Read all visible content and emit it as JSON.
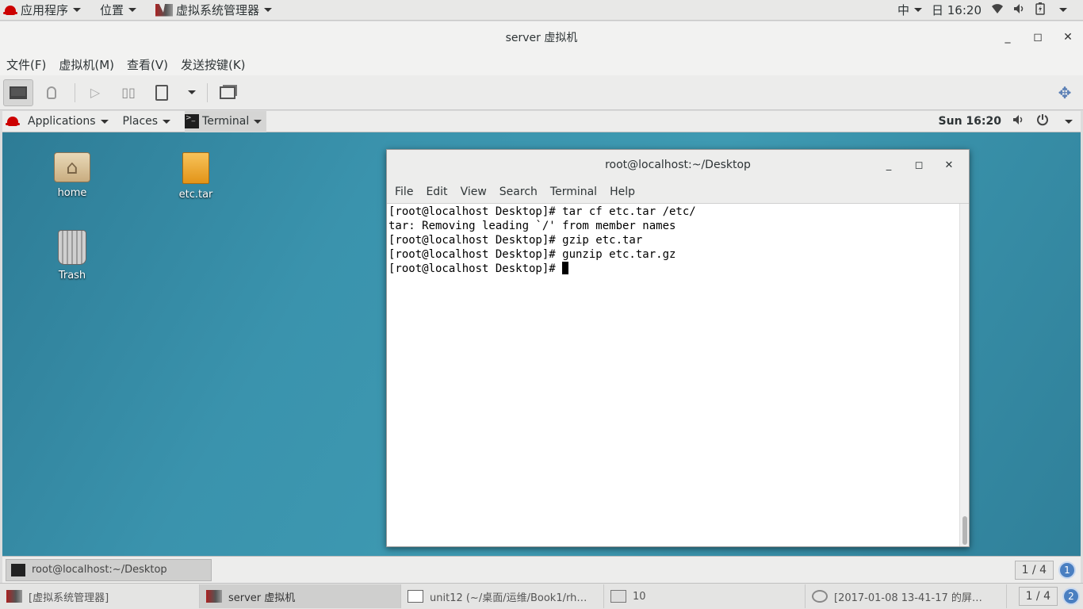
{
  "host_topbar": {
    "apps_menu": "应用程序",
    "places_menu": "位置",
    "vm_manager_menu": "虚拟系统管理器",
    "input_method": "中",
    "clock": "日 16:20"
  },
  "vm_window": {
    "title": "server 虚拟机",
    "menu": [
      "文件(F)",
      "虚拟机(M)",
      "查看(V)",
      "发送按键(K)"
    ]
  },
  "guest": {
    "topbar": {
      "applications": "Applications",
      "places": "Places",
      "terminal": "Terminal",
      "clock": "Sun 16:20"
    },
    "desktop_icons": {
      "home": "home",
      "etc_tar": "etc.tar",
      "trash": "Trash"
    },
    "terminal": {
      "title": "root@localhost:~/Desktop",
      "menu": [
        "File",
        "Edit",
        "View",
        "Search",
        "Terminal",
        "Help"
      ],
      "lines": [
        "[root@localhost Desktop]# tar cf etc.tar /etc/",
        "tar: Removing leading `/' from member names",
        "[root@localhost Desktop]# gzip etc.tar",
        "[root@localhost Desktop]# gunzip etc.tar.gz",
        "[root@localhost Desktop]# "
      ]
    },
    "taskbar": {
      "task": "root@localhost:~/Desktop",
      "workspace": "1 / 4",
      "workspace_badge": "1"
    }
  },
  "host_taskbar": {
    "tasks": [
      "[虚拟系统管理器]",
      "server 虚拟机",
      "unit12 (~/桌面/运维/Book1/rh…",
      "10",
      "[2017-01-08 13-41-17 的屏…"
    ],
    "workspace": "1 / 4",
    "workspace_badge": "2"
  }
}
